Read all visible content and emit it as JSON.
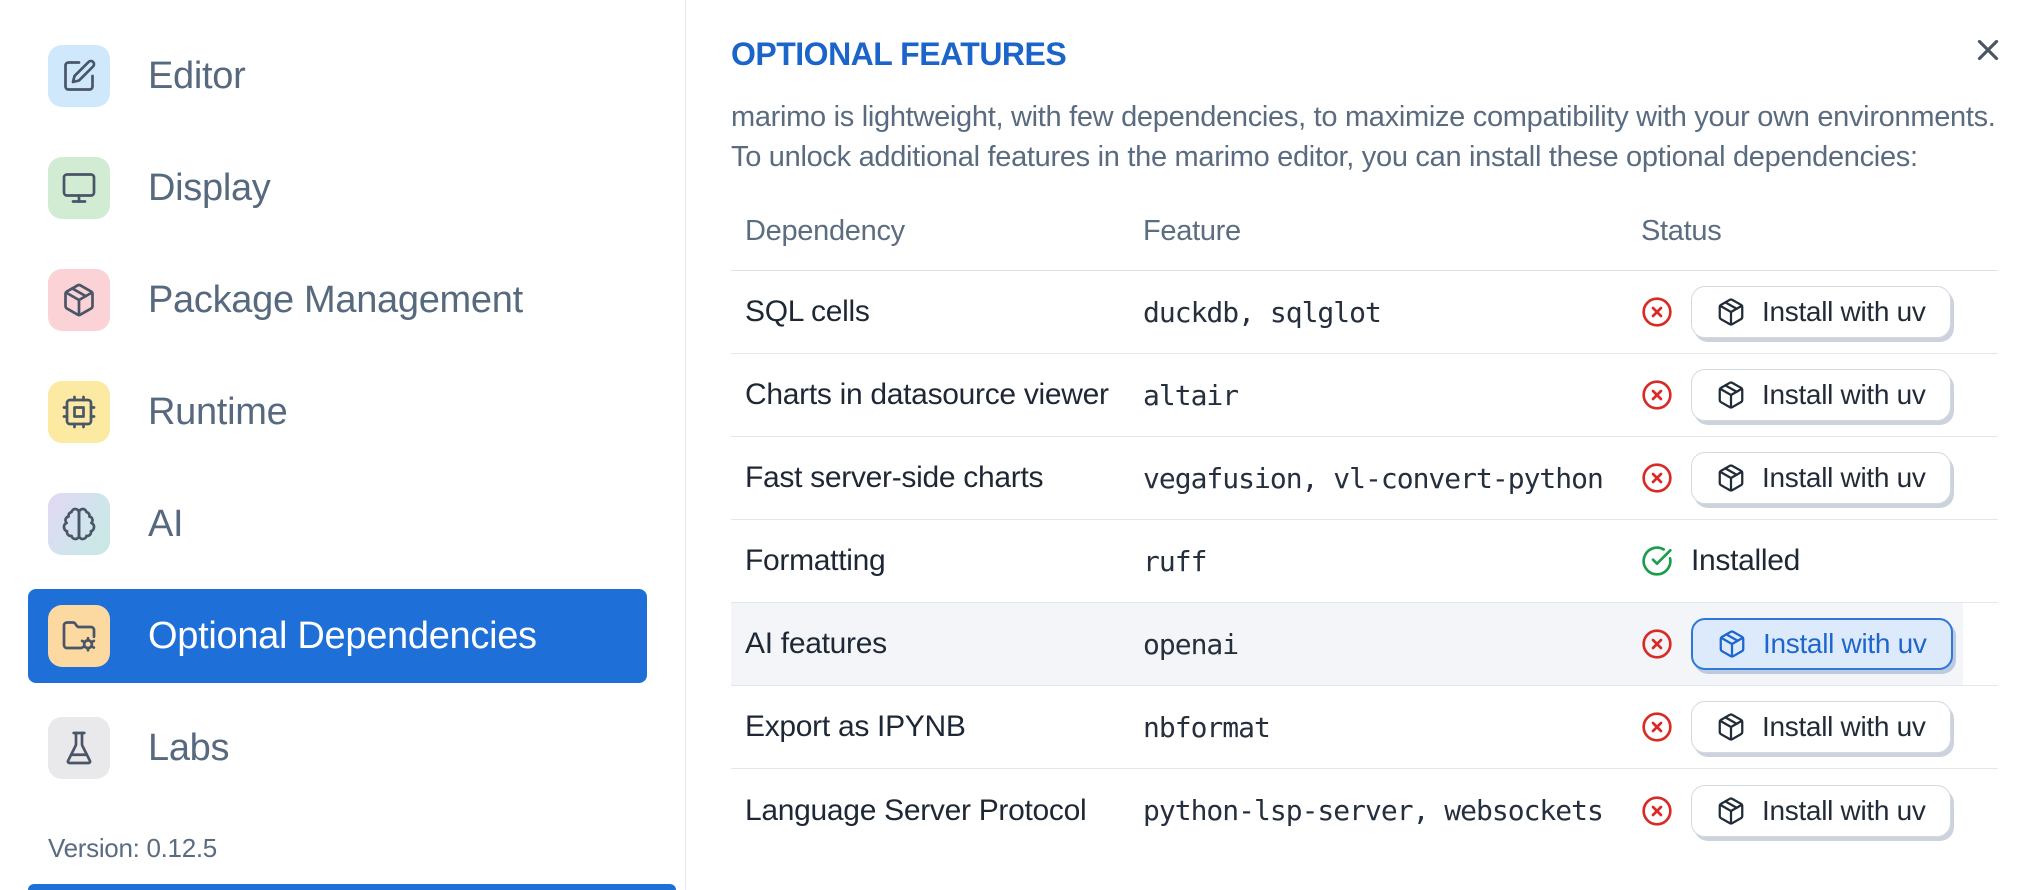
{
  "sidebar": {
    "items": [
      {
        "label": "Editor",
        "icon": "square-pen-icon",
        "tile_color": "#cfe8fc"
      },
      {
        "label": "Display",
        "icon": "monitor-icon",
        "tile_color": "#d2ecd3"
      },
      {
        "label": "Package Management",
        "icon": "package-icon",
        "tile_color": "#fbd3d6"
      },
      {
        "label": "Runtime",
        "icon": "cpu-icon",
        "tile_color": "#fce9a2"
      },
      {
        "label": "AI",
        "icon": "brain-icon",
        "tile_color": "gradient-purple-teal"
      },
      {
        "label": "Optional Dependencies",
        "icon": "folder-cog-icon",
        "tile_color": "#fbd9a1",
        "selected": true
      },
      {
        "label": "Labs",
        "icon": "flask-icon",
        "tile_color": "#e9e9ec"
      }
    ],
    "version_label": "Version: 0.12.5"
  },
  "panel": {
    "title": "OPTIONAL FEATURES",
    "description_lines": [
      "marimo is lightweight, with few dependencies, to maximize compatibility with your own environments.",
      "To unlock additional features in the marimo editor, you can install these optional dependencies:"
    ],
    "close_icon": "x-icon",
    "table": {
      "columns": {
        "dependency": "Dependency",
        "feature": "Feature",
        "status": "Status"
      },
      "installed_label": "Installed",
      "rows": [
        {
          "dependency": "SQL cells",
          "feature": "duckdb, sqlglot",
          "installed": false,
          "action": "Install with uv"
        },
        {
          "dependency": "Charts in datasource viewer",
          "feature": "altair",
          "installed": false,
          "action": "Install with uv"
        },
        {
          "dependency": "Fast server-side charts",
          "feature": "vegafusion, vl-convert-python",
          "installed": false,
          "action": "Install with uv"
        },
        {
          "dependency": "Formatting",
          "feature": "ruff",
          "installed": true,
          "status_text": "Installed"
        },
        {
          "dependency": "AI features",
          "feature": "openai",
          "installed": false,
          "action": "Install with uv",
          "highlighted": true,
          "button_focused": true
        },
        {
          "dependency": "Export as IPYNB",
          "feature": "nbformat",
          "installed": false,
          "action": "Install with uv"
        },
        {
          "dependency": "Language Server Protocol",
          "feature": "python-lsp-server, websockets",
          "installed": false,
          "action": "Install with uv"
        }
      ]
    }
  },
  "colors": {
    "accent_blue": "#1e70d8",
    "title_blue": "#1b64c9",
    "status_error_red": "#d92b26",
    "status_ok_green": "#1a9e4b",
    "row_highlight": "#f3f5f8",
    "divider": "#e2e7ee",
    "text_slate": "#5a6b80",
    "text_dark": "#1e2734"
  }
}
